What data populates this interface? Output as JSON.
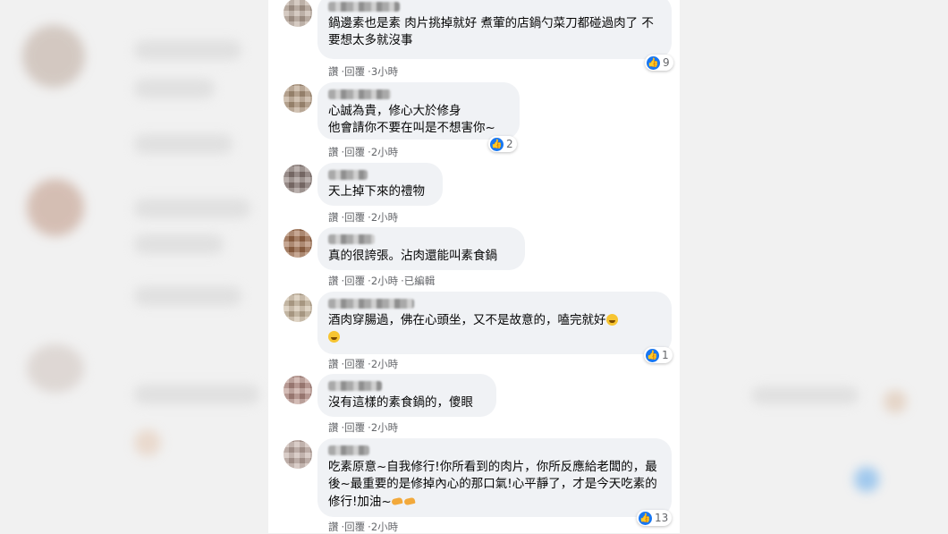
{
  "colors": {
    "like_blue": "#1877f2",
    "bubble": "#f0f2f5",
    "meta": "#65676b"
  },
  "actions": {
    "like": "讚",
    "reply": "回覆",
    "sep": "·"
  },
  "comments": [
    {
      "text": "鍋邊素也是素 肉片挑掉就好 煮葷的店鍋勺菜刀都碰過肉了 不要想太多就沒事",
      "time": "3小時",
      "reactions": "9"
    },
    {
      "text": "心誠為貴，修心大於修身\n他會請你不要在叫是不想害你~",
      "time": "2小時",
      "reactions": "2"
    },
    {
      "text": "天上掉下來的禮物",
      "time": "2小時",
      "reactions": ""
    },
    {
      "text": "真的很誇張。沾肉還能叫素食鍋",
      "time": "2小時",
      "edited": "已編輯",
      "reactions": ""
    },
    {
      "text": "酒肉穿腸過，佛在心頭坐，又不是故意的，嗑完就好",
      "time": "2小時",
      "reactions": "1"
    },
    {
      "text": "沒有這樣的素食鍋的，傻眼",
      "time": "2小時",
      "reactions": ""
    },
    {
      "text": "吃素原意~自我修行!你所看到的肉片，你所反應給老闆的，最後~最重要的是修掉內心的那口氣!心平靜了，才是今天吃素的修行!加油~",
      "time": "2小時",
      "reactions": "13"
    }
  ]
}
